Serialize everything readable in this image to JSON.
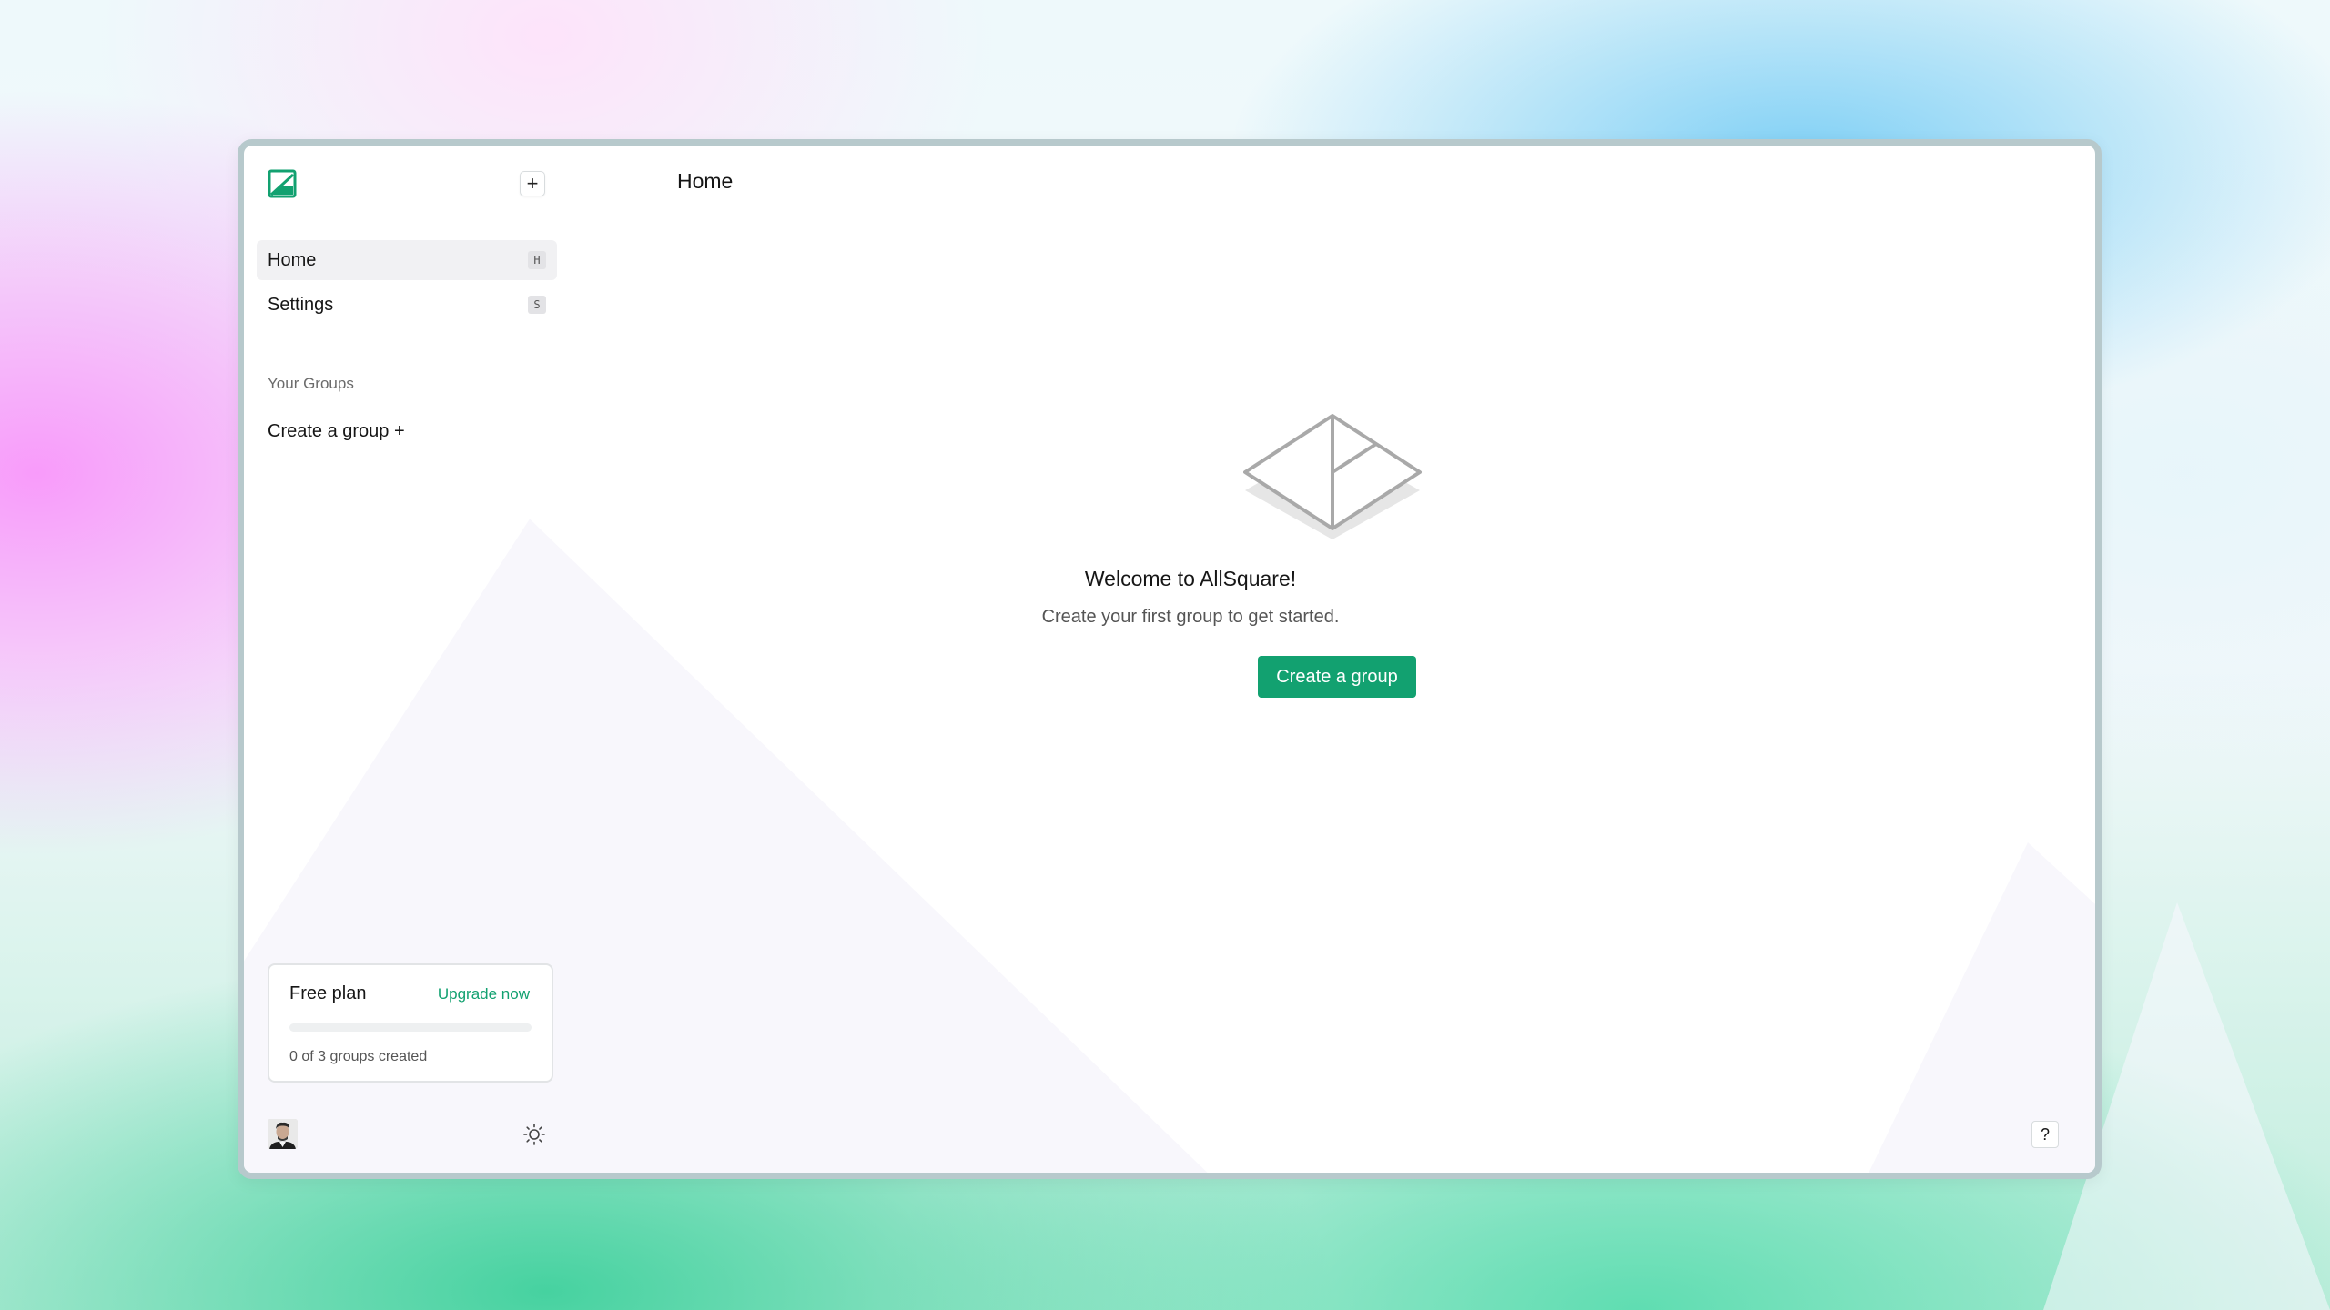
{
  "app": {
    "name": "AllSquare",
    "accent_color": "#12a170"
  },
  "sidebar": {
    "logo_icon": "allsquare-logo-icon",
    "new_button_label": "+",
    "nav": [
      {
        "label": "Home",
        "shortcut": "H",
        "active": true
      },
      {
        "label": "Settings",
        "shortcut": "S",
        "active": false
      }
    ],
    "groups_section_label": "Your Groups",
    "create_group_link": "Create a group +",
    "plan": {
      "title": "Free plan",
      "upgrade_label": "Upgrade now",
      "groups_used": 0,
      "groups_limit": 3,
      "usage_text": "0 of 3 groups created"
    },
    "avatar_icon": "user-avatar",
    "theme_toggle_icon": "sun-icon"
  },
  "main": {
    "page_title": "Home",
    "empty_state": {
      "illustration_icon": "isometric-square-icon",
      "title": "Welcome to AllSquare!",
      "subtitle": "Create your first group to get started.",
      "button_label": "Create a group"
    },
    "help_button_label": "?"
  }
}
